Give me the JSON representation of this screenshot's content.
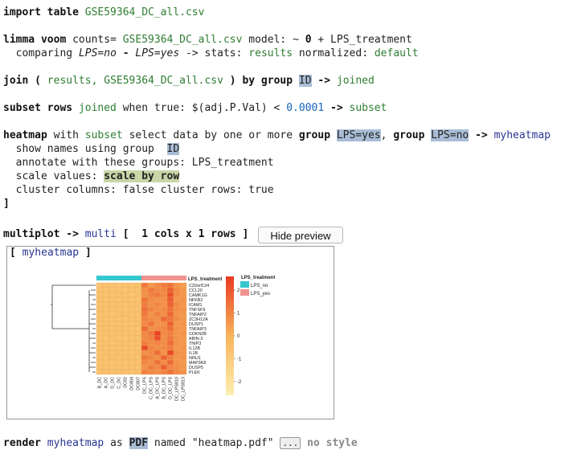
{
  "import": {
    "kw": "import table",
    "file": "GSE59364_DC_all.csv"
  },
  "limma": {
    "kw": "limma voom",
    "counts_label": "counts=",
    "file": "GSE59364_DC_all.csv",
    "model_label": "model: ~",
    "zero": "0",
    "plus": "+",
    "factor": "LPS_treatment",
    "comparing_label": "comparing",
    "cmp_a": "LPS=no",
    "dash": "-",
    "cmp_b": "LPS=yes",
    "stats_label": "-> stats:",
    "stats_val": "results",
    "norm_label": "normalized:",
    "norm_val": "default"
  },
  "join": {
    "kw1": "join (",
    "a": "results,",
    "b": "GSE59364_DC_all.csv",
    "kw2": ") by group",
    "key": "ID",
    "arrow": "->",
    "out": "joined"
  },
  "subset": {
    "kw": "subset rows",
    "src": "joined",
    "when": "when true: $(adj.P.Val) <",
    "thr": "0.0001",
    "arrow": "->",
    "out": "subset"
  },
  "heatmap": {
    "kw": "heatmap",
    "with": "with",
    "src": "subset",
    "sel": "select data by one or more",
    "grp": "group",
    "g1": "LPS=yes",
    "comma": ",",
    "g2": "LPS=no",
    "arrow": "->",
    "out": "myheatmap",
    "show_label": "show names using group",
    "show_val": "ID",
    "annot": "annotate with these groups: LPS_treatment",
    "scale_label": "scale values:",
    "scale_val": "scale by row",
    "cluster": "cluster columns: false cluster rows: true",
    "close": "]"
  },
  "multiplot": {
    "kw": "multiplot",
    "arrow": "->",
    "out": "multi",
    "open": "[",
    "spec": "1 cols x 1 rows",
    "close": "]",
    "button": "Hide preview"
  },
  "preview": {
    "title_open": "[",
    "title": "myheatmap",
    "title_close": "]"
  },
  "render": {
    "kw": "render",
    "obj": "myheatmap",
    "as": "as",
    "fmt": "PDF",
    "named": "named \"heatmap.pdf\"",
    "dots": "...",
    "style": "no style"
  },
  "chart_data": {
    "type": "heatmap",
    "annotation_title": "LPS_treatment",
    "annotation_legend": [
      "LPS_no",
      "LPS_yes"
    ],
    "colors": {
      "LPS_no": "#36c7cf",
      "LPS_yes": "#f0938e",
      "low": "#fdefb0",
      "mid": "#f8b35a",
      "high": "#e83a23"
    },
    "rows": [
      "C20orf134",
      "CCL20",
      "CAMK1G",
      "NFKB2",
      "ICAM1",
      "TNFSF9",
      "TNFAIP2",
      "ZC3H12A",
      "DUSP1",
      "TNFAIP3",
      "CDKN2B",
      "ABIN-3",
      "TNIP3",
      "IL12B",
      "IL1B",
      "NINJ1",
      "MAP3K8",
      "DUSP5",
      "PLEK"
    ],
    "columns": [
      "B_DC",
      "A_DC",
      "D_DC",
      "C_DC",
      "DC82",
      "DC804",
      "DC807",
      "DC_LPS",
      "C_DC_LPS",
      "A_DC_LPS",
      "B_DC_LPS",
      "D_DC_LPS",
      "DC_LPS810",
      "DC_LPS813"
    ],
    "column_groups": [
      "LPS_no",
      "LPS_no",
      "LPS_no",
      "LPS_no",
      "LPS_no",
      "LPS_no",
      "LPS_no",
      "LPS_yes",
      "LPS_yes",
      "LPS_yes",
      "LPS_yes",
      "LPS_yes",
      "LPS_yes",
      "LPS_yes"
    ],
    "values": [
      [
        -0.7,
        -0.6,
        -0.7,
        -0.8,
        -0.6,
        -0.7,
        -0.6,
        1.3,
        0.6,
        0.9,
        1.2,
        1.4,
        0.7,
        0.5
      ],
      [
        -0.6,
        -0.7,
        -0.6,
        -0.7,
        -0.8,
        -0.6,
        -0.7,
        0.8,
        1.3,
        0.9,
        1.0,
        1.8,
        0.9,
        0.6
      ],
      [
        -0.7,
        -0.6,
        -0.7,
        -0.6,
        -0.7,
        -0.8,
        -0.6,
        0.7,
        1.1,
        1.3,
        0.9,
        2.1,
        0.8,
        0.6
      ],
      [
        -0.6,
        -0.7,
        -0.6,
        -0.7,
        -0.6,
        -0.7,
        -0.7,
        1.4,
        0.9,
        0.7,
        0.8,
        1.9,
        0.6,
        0.7
      ],
      [
        -0.7,
        -0.6,
        -0.7,
        -0.6,
        -0.7,
        -0.6,
        -0.6,
        1.2,
        0.8,
        1.0,
        0.7,
        1.8,
        0.9,
        0.6
      ],
      [
        -0.6,
        -0.7,
        -0.6,
        -0.7,
        -0.7,
        -0.6,
        -0.7,
        1.5,
        1.0,
        0.8,
        0.9,
        1.4,
        0.8,
        0.7
      ],
      [
        -0.7,
        -0.6,
        -0.7,
        -0.6,
        -0.6,
        -0.7,
        -0.6,
        1.3,
        0.7,
        1.1,
        0.8,
        1.7,
        0.7,
        0.6
      ],
      [
        -0.6,
        -0.7,
        -0.6,
        -0.7,
        -0.7,
        -0.6,
        -0.7,
        1.1,
        0.9,
        0.8,
        1.6,
        1.3,
        0.9,
        0.6
      ],
      [
        -0.7,
        -0.6,
        -0.7,
        -0.6,
        -0.7,
        -0.7,
        -0.6,
        0.9,
        1.4,
        0.7,
        0.8,
        1.8,
        0.6,
        0.7
      ],
      [
        -0.6,
        -0.7,
        -0.6,
        -0.7,
        -0.6,
        -0.7,
        -0.7,
        1.6,
        0.8,
        0.9,
        1.0,
        1.5,
        0.7,
        0.6
      ],
      [
        -0.7,
        -0.6,
        -0.7,
        -0.6,
        -0.7,
        -0.6,
        -0.6,
        1.0,
        1.3,
        2.4,
        0.9,
        1.1,
        0.6,
        0.7
      ],
      [
        -0.6,
        -0.7,
        -0.6,
        -0.7,
        -0.7,
        -0.6,
        -0.7,
        0.9,
        1.1,
        2.1,
        0.8,
        1.3,
        0.7,
        0.6
      ],
      [
        -0.7,
        -0.6,
        -0.7,
        -0.6,
        -0.6,
        -0.7,
        -0.6,
        1.2,
        0.9,
        1.0,
        0.8,
        1.6,
        0.7,
        0.6
      ],
      [
        -0.6,
        -0.7,
        -0.6,
        -0.7,
        -0.7,
        -0.6,
        -0.7,
        2.2,
        1.0,
        0.8,
        0.9,
        1.2,
        0.6,
        0.7
      ],
      [
        -0.7,
        -0.6,
        -0.7,
        -0.6,
        -0.7,
        -0.7,
        -0.6,
        0.8,
        0.9,
        1.5,
        0.7,
        2.3,
        0.8,
        0.6
      ],
      [
        -0.6,
        -0.7,
        -0.6,
        -0.7,
        -0.6,
        -0.6,
        -0.7,
        1.3,
        1.0,
        0.8,
        1.7,
        1.1,
        0.6,
        0.7
      ],
      [
        -0.7,
        -0.6,
        -0.7,
        -0.6,
        -0.7,
        -0.7,
        -0.6,
        1.0,
        0.8,
        1.4,
        0.9,
        1.6,
        0.7,
        0.6
      ],
      [
        -0.6,
        -0.7,
        -0.6,
        -0.7,
        -0.7,
        -0.6,
        -0.7,
        0.7,
        1.2,
        0.9,
        1.8,
        1.0,
        0.8,
        0.6
      ],
      [
        -0.7,
        -0.6,
        -0.7,
        -0.6,
        -0.6,
        -0.7,
        -0.6,
        1.1,
        0.9,
        0.8,
        1.0,
        1.4,
        0.9,
        0.7
      ]
    ],
    "scale_ticks": [
      2,
      1,
      0,
      -1,
      -2
    ],
    "scale_range": [
      -2.6,
      2.6
    ]
  }
}
